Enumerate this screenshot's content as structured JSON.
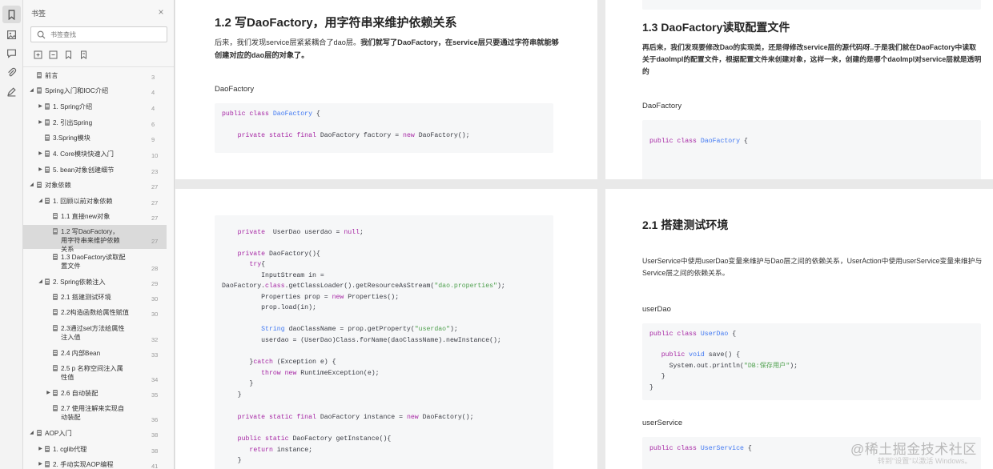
{
  "sidebar": {
    "title": "书签",
    "search_placeholder": "书签查找",
    "rail_icons": [
      "bookmark-icon",
      "thumbnail-icon",
      "comment-icon",
      "attachment-icon",
      "signature-icon"
    ],
    "tool_icons": [
      "expand-all-icon",
      "collapse-all-icon",
      "add-bookmark-icon",
      "bookmark-outline-icon"
    ],
    "items": [
      {
        "label": "前言",
        "page": "3"
      },
      {
        "label": "Spring入门和IOC介绍",
        "page": "4"
      },
      {
        "label": "1. Spring介绍",
        "page": "4"
      },
      {
        "label": "2. 引出Spring",
        "page": "6"
      },
      {
        "label": "3.Spring模块",
        "page": "9"
      },
      {
        "label": "4. Core模块快速入门",
        "page": "10"
      },
      {
        "label": "5. bean对象创建细节",
        "page": "23"
      },
      {
        "label": "对象依赖",
        "page": "27"
      },
      {
        "label": "1. 回顾以前对象依赖",
        "page": "27"
      },
      {
        "label": "1.1 直接new对象",
        "page": "27"
      },
      {
        "label": "1.2 写DaoFactory，用字符串来维护依赖关系",
        "page": "27"
      },
      {
        "label": "1.3 DaoFactory读取配置文件",
        "page": "28"
      },
      {
        "label": "2. Spring依赖注入",
        "page": "29"
      },
      {
        "label": "2.1 搭建测试环境",
        "page": "30"
      },
      {
        "label": "2.2构造函数给属性赋值",
        "page": "30"
      },
      {
        "label": "2.3通过set方法给属性注入值",
        "page": "32"
      },
      {
        "label": "2.4 内部Bean",
        "page": "33"
      },
      {
        "label": "2.5 p 名称空间注入属性值",
        "page": "34"
      },
      {
        "label": "2.6 自动装配",
        "page": "35"
      },
      {
        "label": "2.7 使用注解来实现自动装配",
        "page": "36"
      },
      {
        "label": "AOP入门",
        "page": "38"
      },
      {
        "label": "1. cglib代理",
        "page": "38"
      },
      {
        "label": "2. 手动实现AOP编程",
        "page": "41"
      }
    ]
  },
  "page1": {
    "heading": "1.2 写DaoFactory，用字符串来维护依赖关系",
    "para": [
      "后来，我们发现service层紧紧耦合了dao层。",
      "我们就写了DaoFactory，在service层只要通过字符串就能够创建对应的dao层的对象了。"
    ],
    "caption": "DaoFactory",
    "code": [
      "public class DaoFactory {",
      "",
      "    private static final DaoFactory factory = new DaoFactory();"
    ]
  },
  "page2": {
    "heading": "1.3 DaoFactory读取配置文件",
    "para": [
      "再后来，我们发现要修改Dao的实现类，还是得修改service层的源代码呀..于是我们就在DaoFactory中读取关于daoImpl的配置文件，根据配置文件来创建对象，这样一来，创建的是哪个daoImpl对service层就是透明的"
    ],
    "caption": "DaoFactory",
    "code": [
      "public class DaoFactory {"
    ]
  },
  "page3": {
    "code": [
      "    private  UserDao userdao = null;",
      "",
      "    private DaoFactory(){",
      "       try{",
      "          InputStream in =",
      "DaoFactory.class.getClassLoader().getResourceAsStream(\"dao.properties\");",
      "          Properties prop = new Properties();",
      "          prop.load(in);",
      "",
      "          String daoClassName = prop.getProperty(\"userdao\");",
      "          userdao = (UserDao)Class.forName(daoClassName).newInstance();",
      "",
      "       }catch (Exception e) {",
      "          throw new RuntimeException(e);",
      "       }",
      "    }",
      "",
      "    private static final DaoFactory instance = new DaoFactory();",
      "",
      "    public static DaoFactory getInstance(){",
      "       return instance;",
      "    }"
    ]
  },
  "page4": {
    "heading": "2.1 搭建测试环境",
    "para": [
      "UserService中使用userDao变量来维护与Dao层之间的依赖关系，UserAction中使用userService变量来维护与Service层之间的依赖关系。"
    ],
    "caption1": "userDao",
    "code1": [
      "public class UserDao {",
      "",
      "   public void save() {",
      "     System.out.println(\"DB:保存用户\");",
      "   }",
      "}"
    ],
    "caption2": "userService",
    "code2": [
      "public class UserService {"
    ]
  },
  "watermark": {
    "brand": "@稀土掘金技术社区",
    "activation": "转到\"设置\"以激活 Windows。"
  }
}
